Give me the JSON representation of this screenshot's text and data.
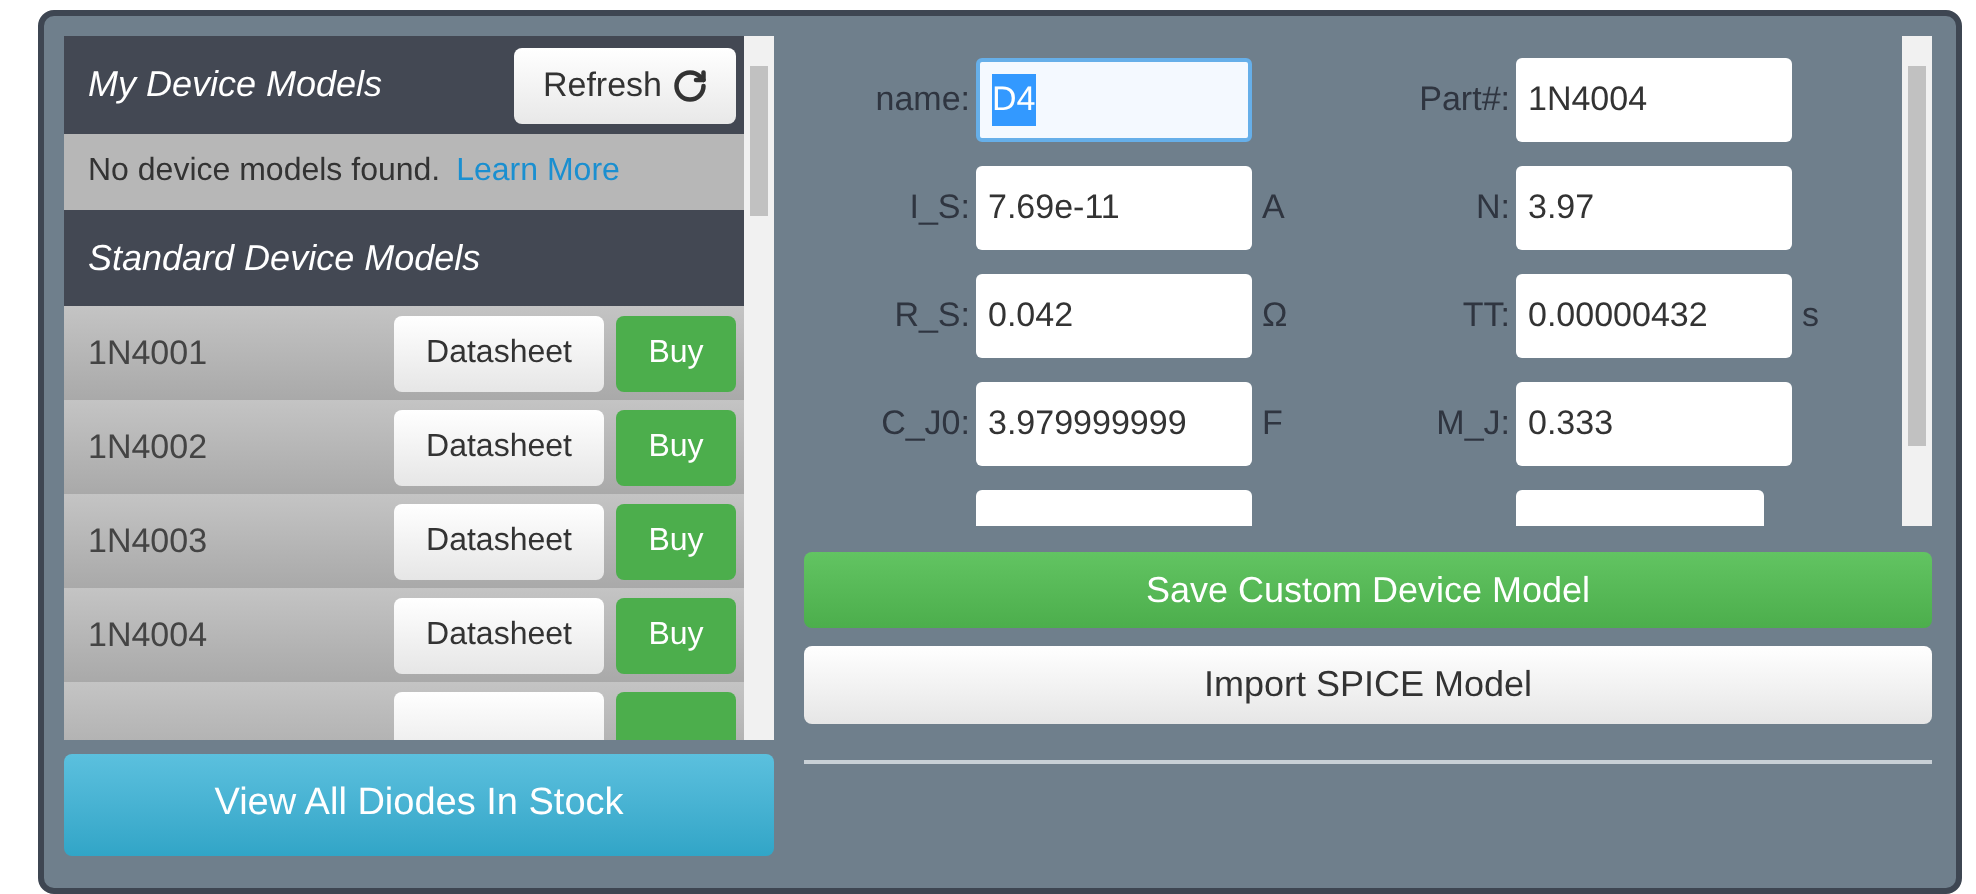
{
  "my_models": {
    "title": "My Device Models",
    "refresh_button": "Refresh",
    "empty_message": "No device models found.",
    "learn_more_link": "Learn More"
  },
  "standard_models": {
    "title": "Standard Device Models",
    "rows": [
      {
        "part": "1N4001",
        "datasheet_button": "Datasheet",
        "buy_button": "Buy"
      },
      {
        "part": "1N4002",
        "datasheet_button": "Datasheet",
        "buy_button": "Buy"
      },
      {
        "part": "1N4003",
        "datasheet_button": "Datasheet",
        "buy_button": "Buy"
      },
      {
        "part": "1N4004",
        "datasheet_button": "Datasheet",
        "buy_button": "Buy"
      }
    ]
  },
  "view_all_button": "View All Diodes In Stock",
  "form": {
    "fields": [
      {
        "label": "name:",
        "value": "D4",
        "text_selected": true
      },
      {
        "label": "Part#:",
        "value": "1N4004",
        "text_selected": false
      },
      {
        "label": "I_S:",
        "value": "7.69e-11",
        "unit": "A",
        "text_selected": false
      },
      {
        "label": "N:",
        "value": "3.97",
        "text_selected": false
      },
      {
        "label": "R_S:",
        "value": "0.042",
        "unit": "Ω",
        "text_selected": false
      },
      {
        "label": "TT:",
        "value": "0.00000432",
        "unit": "s",
        "text_selected": false
      },
      {
        "label": "C_J0:",
        "value": "3.979999999",
        "unit": "F",
        "text_selected": false
      },
      {
        "label": "M_J:",
        "value": "0.333",
        "text_selected": false
      }
    ]
  },
  "save_button": "Save Custom Device Model",
  "import_button": "Import SPICE Model"
}
